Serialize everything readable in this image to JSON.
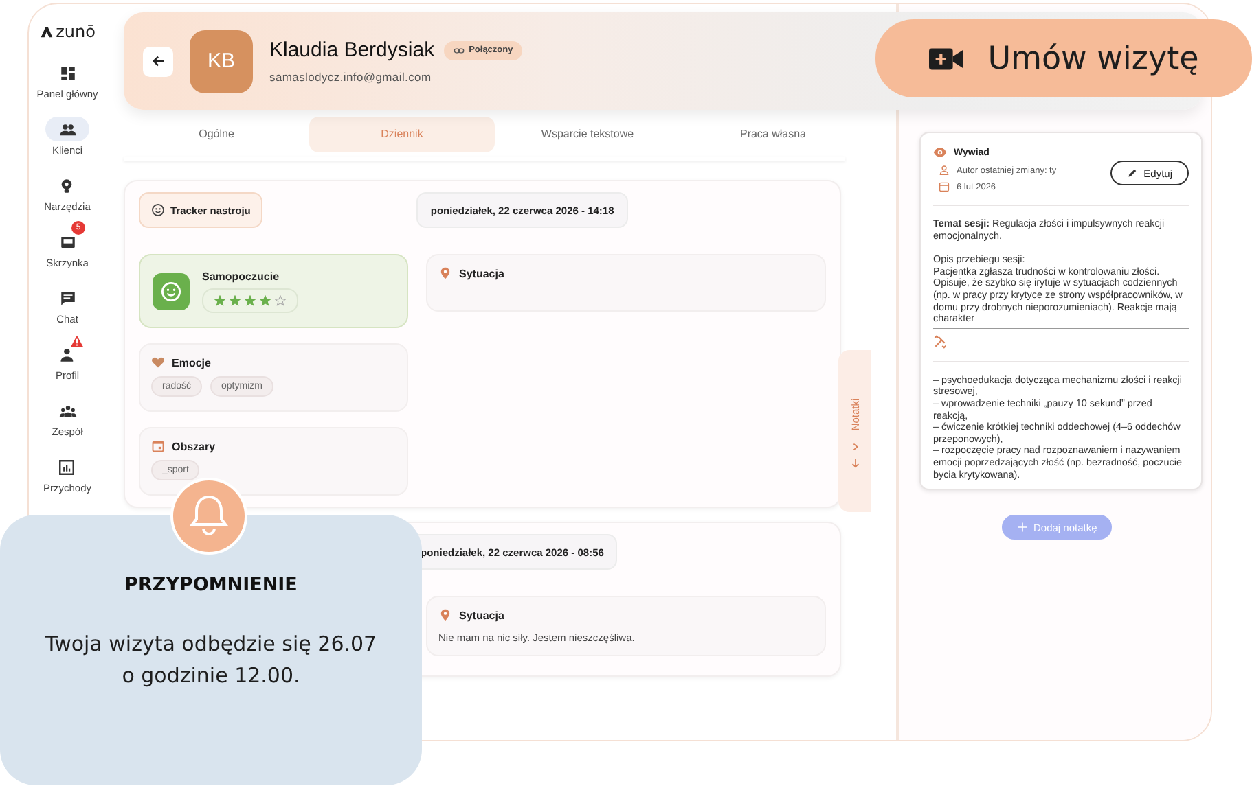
{
  "logo": "zunō",
  "sidebar": {
    "items": [
      {
        "label": "Panel główny",
        "selected": false
      },
      {
        "label": "Klienci",
        "selected": true
      },
      {
        "label": "Narzędzia",
        "selected": false
      },
      {
        "label": "Skrzynka",
        "selected": false,
        "badge": "5"
      },
      {
        "label": "Chat",
        "selected": false
      },
      {
        "label": "Profil",
        "selected": false,
        "warning": true
      },
      {
        "label": "Zespół",
        "selected": false
      },
      {
        "label": "Przychody",
        "selected": false
      }
    ]
  },
  "client": {
    "initials": "KB",
    "name": "Klaudia Berdysiak",
    "status": "Połączony",
    "email": "samaslodycz.info@gmail.com"
  },
  "book_button": "Umów wizytę",
  "tabs": [
    {
      "label": "Ogólne",
      "selected": false
    },
    {
      "label": "Dziennik",
      "selected": true
    },
    {
      "label": "Wsparcie tekstowe",
      "selected": false
    },
    {
      "label": "Praca własna",
      "selected": false
    }
  ],
  "entries": [
    {
      "tracker_label": "Tracker nastroju",
      "timestamp": "poniedziałek, 22 czerwca 2026 - 14:18",
      "mood": {
        "title": "Samopoczucie",
        "stars": 4
      },
      "emotions": {
        "title": "Emocje",
        "tags": [
          "radość",
          "optymizm"
        ]
      },
      "areas": {
        "title": "Obszary",
        "tags": [
          "_sport"
        ]
      },
      "situation": {
        "title": "Sytuacja"
      }
    },
    {
      "timestamp": "poniedziałek, 22 czerwca 2026 - 08:56",
      "situation": {
        "title": "Sytuacja",
        "text": "Nie mam na nic siły. Jestem nieszczęśliwa."
      }
    }
  ],
  "notes_tab": "Notatki",
  "note": {
    "title": "Wywiad",
    "author": "Autor ostatniej zmiany: ty",
    "date": "6 lut 2026",
    "edit_button": "Edytuj",
    "topic": "**Temat sesji:** Regulacja złości i impulsywnych reakcji emocjonalnych.",
    "description_heading": "Opis przebiegu sesji:",
    "description": "Pacjentka zgłasza trudności w kontrolowaniu złości. Opisuje, że szybko się irytuje w sytuacjach codziennych (np. w pracy przy krytyce ze strony współpracowników, w domu przy drobnych nieporozumieniach). Reakcje mają charakter",
    "interventions": [
      "– psychoedukacja dotycząca mechanizmu złości i reakcji stresowej,",
      "– wprowadzenie techniki „pauzy 10 sekund” przed reakcją,",
      "– ćwiczenie krótkiej techniki oddechowej (4–6 oddechów przeponowych),",
      "– rozpoczęcie pracy nad rozpoznawaniem i nazywaniem emocji poprzedzających złość (np. bezradność, poczucie bycia krytykowana)."
    ]
  },
  "add_note_button": "Dodaj notatkę",
  "reminder": {
    "title": "PRZYPOMNIENIE",
    "text": "Twoja wizyta odbędzie się 26.07 o godzinie 12.00."
  }
}
